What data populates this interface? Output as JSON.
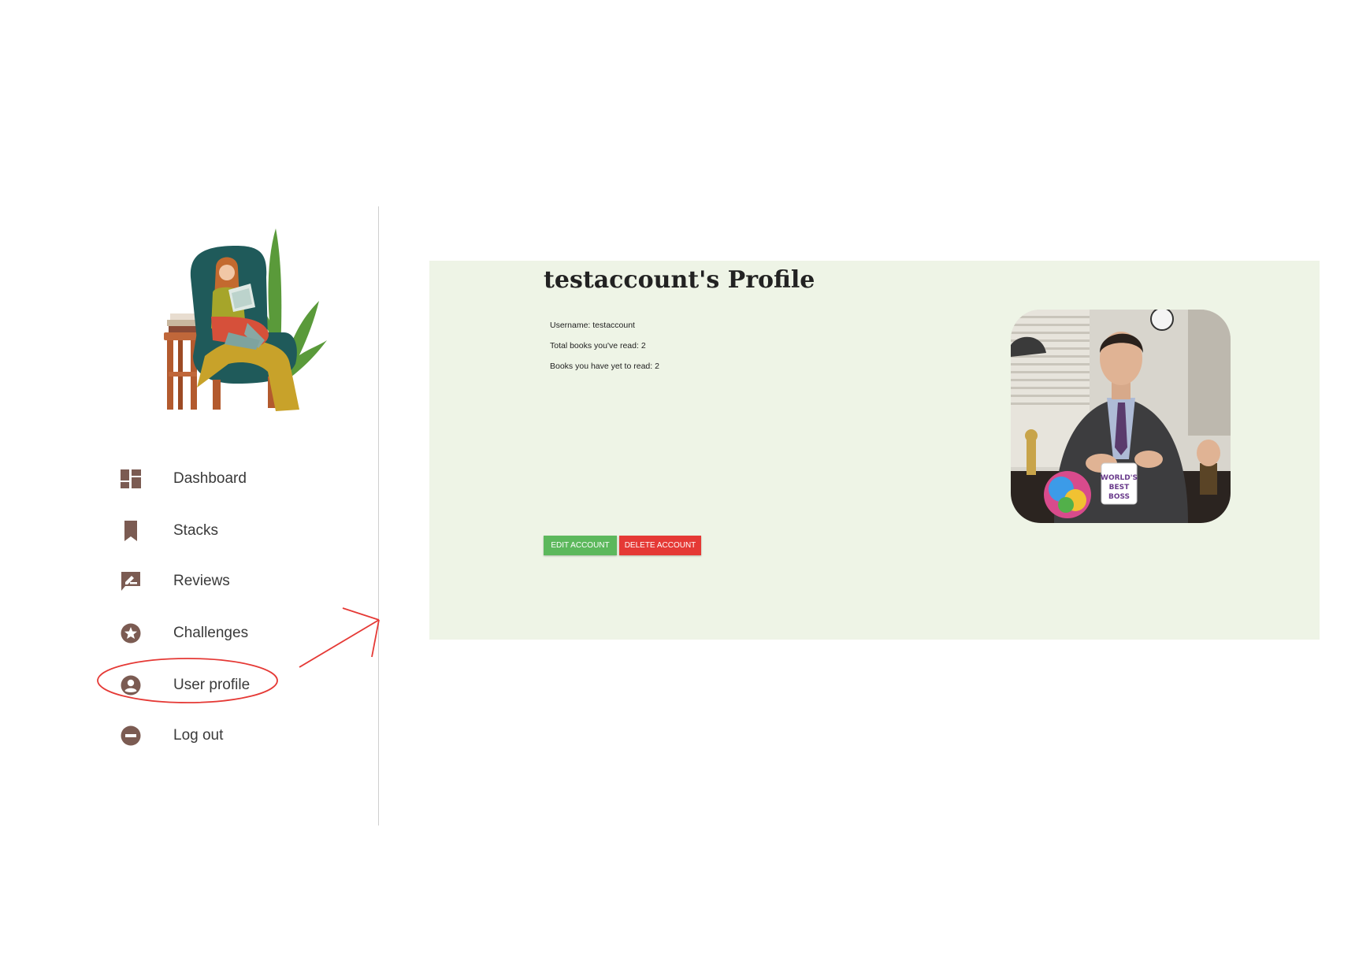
{
  "sidebar": {
    "items": [
      {
        "label": "Dashboard",
        "icon": "dashboard-icon"
      },
      {
        "label": "Stacks",
        "icon": "bookmark-icon"
      },
      {
        "label": "Reviews",
        "icon": "rate-review-icon"
      },
      {
        "label": "Challenges",
        "icon": "star-circle-icon"
      },
      {
        "label": "User profile",
        "icon": "account-circle-icon"
      },
      {
        "label": "Log out",
        "icon": "minus-circle-icon"
      }
    ],
    "icon_color": "#7b5b52"
  },
  "profile": {
    "title": "testaccount's Profile",
    "username_line": "Username: testaccount",
    "total_read_line": "Total books you've read: 2",
    "yet_to_read_line": "Books you have yet to read: 2",
    "mug_text": [
      "WORLD'S",
      "BEST",
      "BOSS"
    ]
  },
  "buttons": {
    "edit_label": "EDIT ACCOUNT",
    "delete_label": "DELETE ACCOUNT"
  },
  "colors": {
    "panel_background": "#eef4e6",
    "edit_button": "#5cb85c",
    "delete_button": "#e53935",
    "annotation": "#e53935"
  }
}
